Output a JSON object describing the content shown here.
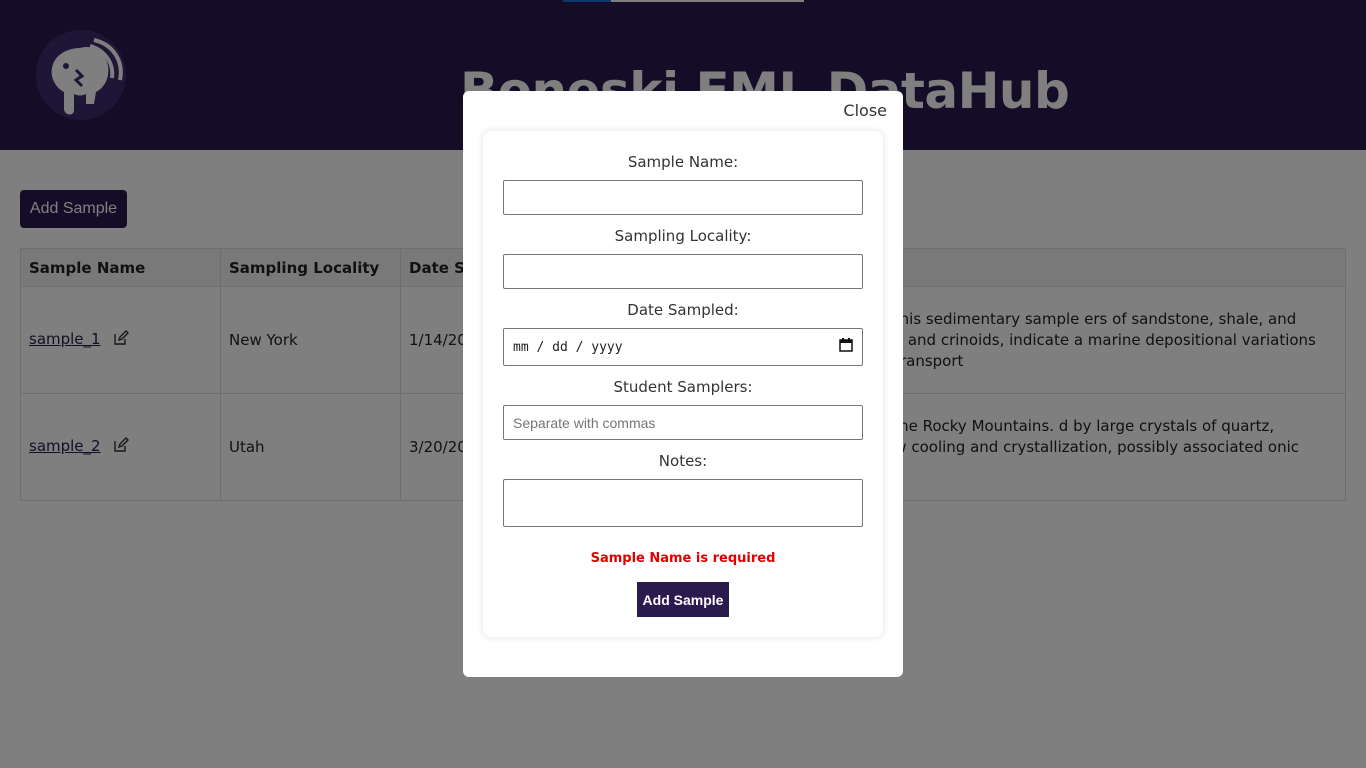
{
  "app": {
    "title": "Boneski EML DataHub",
    "add_sample_label": "Add Sample",
    "logo_icon": "mammoth-logo-icon",
    "loading_progress": 0.2
  },
  "table": {
    "headers": [
      "Sample Name",
      "Sampling Locality",
      "Date Sa",
      ""
    ],
    "rows": [
      {
        "name": "sample_1",
        "locality": "New York",
        "date": "1/14/20",
        "notes": "graphic section in the Grand Canyon, this sedimentary sample ers of sandstone, shale, and limestone. Fossilized marine achiopods and crinoids, indicate a marine depositional variations suggest cyclical changes in sediment transport"
      },
      {
        "name": "sample_2",
        "locality": "Utah",
        "date": "3/20/20",
        "notes": "collected from an exposed outcrop in the Rocky Mountains. d by large crystals of quartz, feldspar, and mica. Field history of slow cooling and crystallization, possibly associated onic intrusion."
      }
    ],
    "edit_icon": "edit-icon"
  },
  "modal": {
    "close_label": "Close",
    "fields": {
      "sample_name_label": "Sample Name:",
      "sample_name_value": "",
      "locality_label": "Sampling Locality:",
      "locality_value": "",
      "date_label": "Date Sampled:",
      "date_placeholder": "mm / dd / yyyy",
      "students_label": "Student Samplers:",
      "students_placeholder": "Separate with commas",
      "notes_label": "Notes:",
      "notes_value": ""
    },
    "error": "Sample Name is required",
    "submit_label": "Add Sample"
  },
  "colors": {
    "brand": "#2a1a4e",
    "error": "#e00000"
  }
}
